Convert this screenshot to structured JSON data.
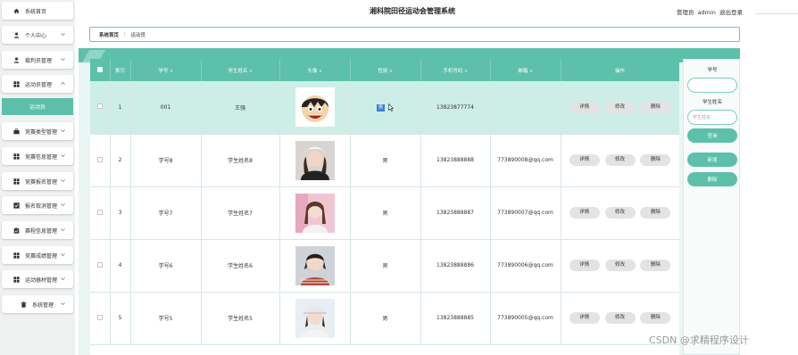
{
  "app": {
    "title": "湘科院田径运动会管理系统"
  },
  "header": {
    "role": "管理员",
    "username": "admin",
    "logout": "退出登录"
  },
  "sidebar": {
    "items": [
      {
        "label": "系统首页",
        "icon": "home-icon",
        "expandable": false
      },
      {
        "label": "个人中心",
        "icon": "user-icon",
        "expandable": true
      },
      {
        "label": "裁判员管理",
        "icon": "user-icon",
        "expandable": true
      },
      {
        "label": "运动员管理",
        "icon": "grid-icon",
        "expandable": true,
        "expanded": true
      },
      {
        "label": "竞赛类型管理",
        "icon": "briefcase-icon",
        "expandable": true
      },
      {
        "label": "竞赛信息管理",
        "icon": "grid-icon",
        "expandable": true
      },
      {
        "label": "竞赛报名管理",
        "icon": "grid-icon",
        "expandable": true
      },
      {
        "label": "报名取消管理",
        "icon": "checkbox-icon",
        "expandable": true
      },
      {
        "label": "赛程信息管理",
        "icon": "clipboard-icon",
        "expandable": true
      },
      {
        "label": "竞赛成绩管理",
        "icon": "grid-icon",
        "expandable": true
      },
      {
        "label": "运动器材管理",
        "icon": "grid-icon",
        "expandable": true
      },
      {
        "label": "系统管理",
        "icon": "trash-icon",
        "expandable": true
      }
    ],
    "active_sub": "运动员"
  },
  "breadcrumb": {
    "home": "系统首页",
    "separator": "⋮",
    "current": "运动员"
  },
  "table": {
    "columns": [
      "索引",
      "学号",
      "学生姓名",
      "头像",
      "性别",
      "手机号码",
      "邮箱",
      "操作"
    ],
    "actions": {
      "detail": "详情",
      "edit": "修改",
      "delete": "删除"
    },
    "rows": [
      {
        "index": "1",
        "student_id": "001",
        "name": "王强",
        "avatar": "cartoon-avatar",
        "gender": "男",
        "phone": "13823877774",
        "email": ""
      },
      {
        "index": "2",
        "student_id": "学号8",
        "name": "学生姓名8",
        "avatar": "photo-avatar",
        "gender": "男",
        "phone": "13823888888",
        "email": "773890008@qq.com"
      },
      {
        "index": "3",
        "student_id": "学号7",
        "name": "学生姓名7",
        "avatar": "photo-avatar",
        "gender": "男",
        "phone": "13823888887",
        "email": "773890007@qq.com"
      },
      {
        "index": "4",
        "student_id": "学号6",
        "name": "学生姓名6",
        "avatar": "photo-avatar",
        "gender": "男",
        "phone": "13823888886",
        "email": "773890006@qq.com"
      },
      {
        "index": "5",
        "student_id": "学号5",
        "name": "学生姓名5",
        "avatar": "photo-avatar",
        "gender": "男",
        "phone": "13823888885",
        "email": "773890005@qq.com"
      }
    ]
  },
  "filter": {
    "student_id_label": "学号",
    "student_id_value": "",
    "name_label": "学生姓名",
    "name_placeholder": "学生姓名",
    "search_button": "查询",
    "add_button": "新增",
    "delete_button": "删除"
  },
  "watermark": "CSDN @求精程序设计",
  "colors": {
    "accent": "#5cc0ab",
    "row_highlight": "#cdeee6",
    "selection": "#3a7bd5"
  }
}
